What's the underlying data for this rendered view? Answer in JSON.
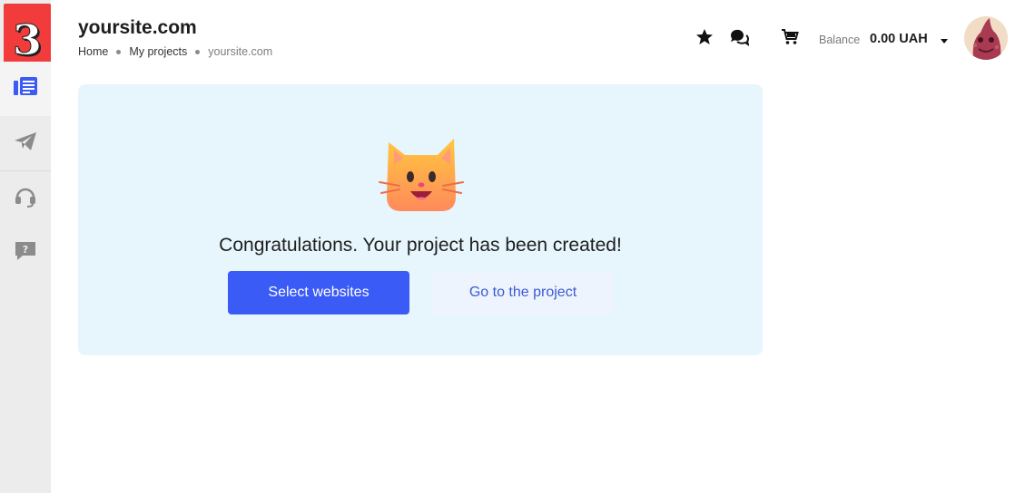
{
  "sidebar": {
    "logo_text": "3",
    "items": [
      {
        "icon": "list-icon",
        "active": true
      },
      {
        "icon": "paper-plane-icon",
        "active": false
      },
      {
        "icon": "headset-icon",
        "active": false
      },
      {
        "icon": "help-chat-icon",
        "active": false
      }
    ]
  },
  "header": {
    "title": "yoursite.com",
    "breadcrumb": [
      "Home",
      "My projects",
      "yoursite.com"
    ],
    "balance_label": "Balance",
    "balance_value": "0.00 UAH"
  },
  "card": {
    "message": "Congratulations. Your project has been created!",
    "primary_button": "Select websites",
    "secondary_button": "Go to the project"
  },
  "colors": {
    "accent": "#3b5bf6",
    "logo_bg": "#f23c3c",
    "card_bg": "#e7f5fc",
    "sidebar_bg": "#ececec"
  }
}
